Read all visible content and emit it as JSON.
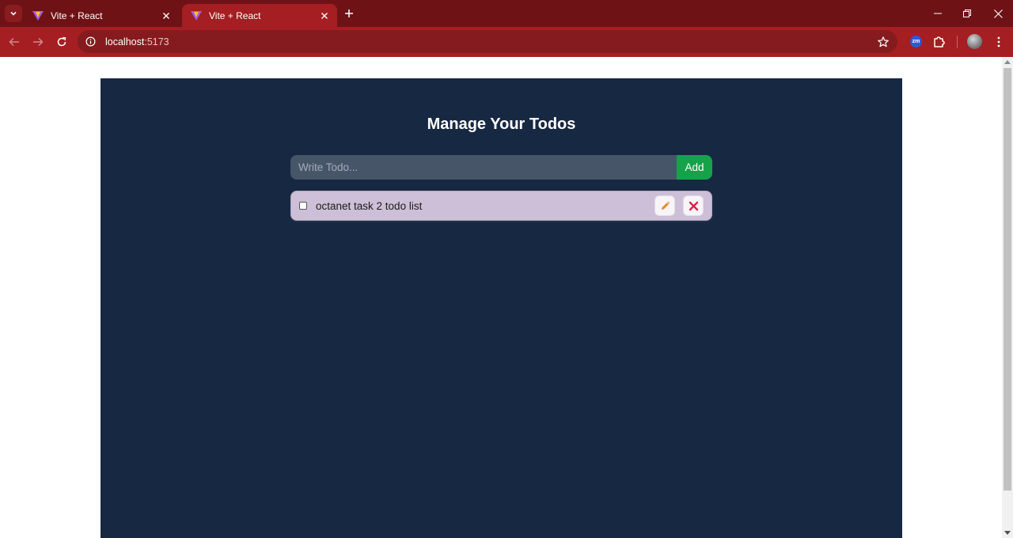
{
  "browser": {
    "tabs": [
      {
        "title": "Vite + React",
        "active": false
      },
      {
        "title": "Vite + React",
        "active": true
      }
    ],
    "url_host": "localhost",
    "url_port": ":5173",
    "extension_label": "zm"
  },
  "app": {
    "title": "Manage Your Todos",
    "input_placeholder": "Write Todo...",
    "input_value": "",
    "add_label": "Add",
    "todos": [
      {
        "text": "octanet task 2 todo list",
        "completed": false
      }
    ]
  },
  "colors": {
    "tab_strip": "#6e1216",
    "toolbar": "#a41e22",
    "panel_bg": "#172842",
    "input_bg": "#475569",
    "add_button": "#15a34a",
    "todo_bg": "#cdbfd8",
    "edit_icon": "#e8862a",
    "delete_icon": "#e11d48"
  }
}
